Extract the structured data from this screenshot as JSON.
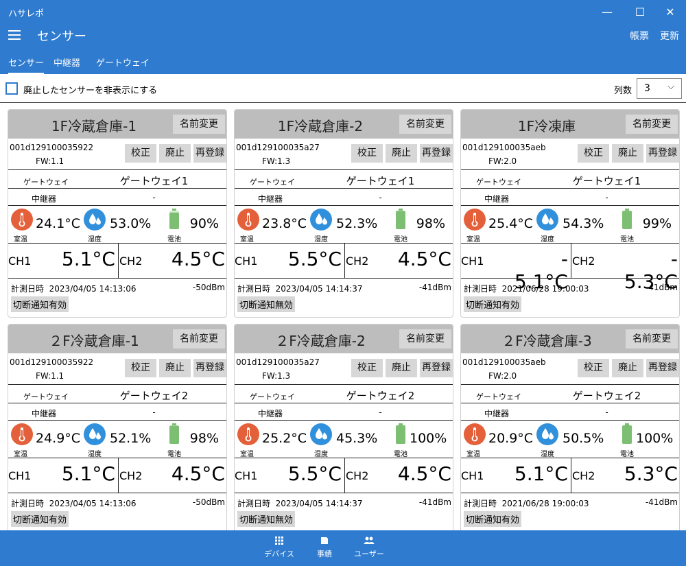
{
  "window": {
    "title": "ハサレポ",
    "minimize": "—",
    "maximize": "☐",
    "close": "✕"
  },
  "header": {
    "title": "センサー",
    "report": "帳票",
    "refresh": "更新"
  },
  "tabs": [
    {
      "label": "センサー"
    },
    {
      "label": "中継器"
    },
    {
      "label": "ゲートウェイ"
    }
  ],
  "filter": {
    "hide_retired_label": "廃止したセンサーを非表示にする",
    "columns_label": "列数",
    "columns_value": "3"
  },
  "card_labels": {
    "rename": "名前変更",
    "calibrate": "校正",
    "retire": "廃止",
    "reregister": "再登録",
    "gateway": "ゲートウェイ",
    "relay": "中継器",
    "room_temp": "室温",
    "humidity": "湿度",
    "battery": "電池",
    "ch1": "CH1",
    "ch2": "CH2",
    "measured": "計測日時"
  },
  "colors": {
    "accent": "#2e7bcf",
    "temp_icon": "#e4603a",
    "humidity_icon": "#3190dc",
    "battery_icon": "#7cbf72",
    "header_gray": "#bdbdbd"
  },
  "cards": [
    {
      "name": "1F冷蔵倉庫-1",
      "device_id": "001d129100035922",
      "fw": "FW:1.1",
      "gateway": "ゲートウェイ1",
      "relay": "-",
      "temp": "24.1°C",
      "humidity": "53.0%",
      "battery": "90%",
      "battery_level": 90,
      "ch1": "5.1°C",
      "ch2": "4.5°C",
      "measured": "2023/04/05 14:13:06",
      "rssi": "-50dBm",
      "notify": "切断通知有効"
    },
    {
      "name": "1F冷蔵倉庫-2",
      "device_id": "001d129100035a27",
      "fw": "FW:1.3",
      "gateway": "ゲートウェイ1",
      "relay": "-",
      "temp": "23.8°C",
      "humidity": "52.3%",
      "battery": "98%",
      "battery_level": 98,
      "ch1": "5.5°C",
      "ch2": "4.5°C",
      "measured": "2023/04/05 14:14:37",
      "rssi": "-41dBm",
      "notify": "切断通知無効"
    },
    {
      "name": "1F冷凍庫",
      "device_id": "001d129100035aeb",
      "fw": "FW:2.0",
      "gateway": "ゲートウェイ1",
      "relay": "-",
      "temp": "25.4°C",
      "humidity": "54.3%",
      "battery": "99%",
      "battery_level": 99,
      "ch1": "- 5.1°C",
      "ch2": "- 5.3°C",
      "measured": "2021/06/28 19:00:03",
      "rssi": "-41dBm",
      "notify": "切断通知有効"
    },
    {
      "name": "２F冷蔵倉庫-1",
      "device_id": "001d129100035922",
      "fw": "FW:1.1",
      "gateway": "ゲートウェイ2",
      "relay": "-",
      "temp": "24.9°C",
      "humidity": "52.1%",
      "battery": "98%",
      "battery_level": 98,
      "ch1": "5.1°C",
      "ch2": "4.5°C",
      "measured": "2023/04/05 14:13:06",
      "rssi": "-50dBm",
      "notify": "切断通知有効"
    },
    {
      "name": "２F冷蔵倉庫-2",
      "device_id": "001d129100035a27",
      "fw": "FW:1.3",
      "gateway": "ゲートウェイ2",
      "relay": "-",
      "temp": "25.2°C",
      "humidity": "45.3%",
      "battery": "100%",
      "battery_level": 100,
      "ch1": "5.5°C",
      "ch2": "4.5°C",
      "measured": "2023/04/05 14:14:37",
      "rssi": "-41dBm",
      "notify": "切断通知無効"
    },
    {
      "name": "２F冷蔵倉庫-3",
      "device_id": "001d129100035aeb",
      "fw": "FW:2.0",
      "gateway": "ゲートウェイ2",
      "relay": "-",
      "temp": "20.9°C",
      "humidity": "50.5%",
      "battery": "100%",
      "battery_level": 100,
      "ch1": "5.1°C",
      "ch2": "5.3°C",
      "measured": "2021/06/28 19:00:03",
      "rssi": "-41dBm",
      "notify": "切断通知有効"
    }
  ],
  "bottom_nav": [
    {
      "label": "デバイス",
      "icon": "grid-icon"
    },
    {
      "label": "事績",
      "icon": "tag-icon"
    },
    {
      "label": "ユーザー",
      "icon": "users-icon"
    }
  ]
}
